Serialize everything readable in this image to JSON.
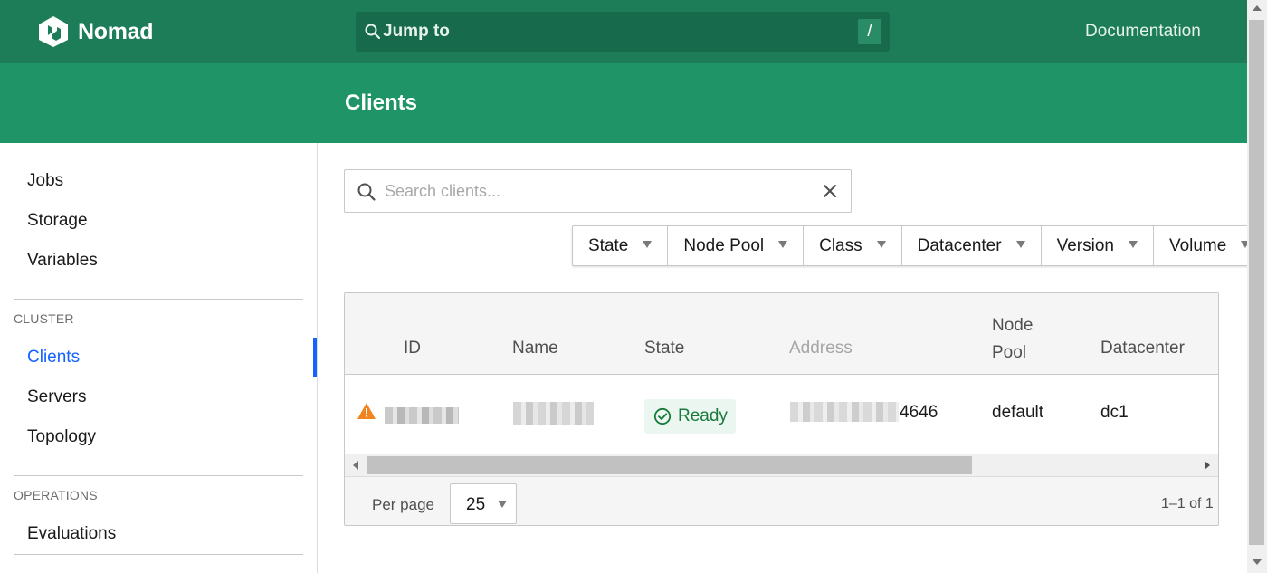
{
  "app": {
    "name": "Nomad",
    "logo_icon": "nomad-logo-icon"
  },
  "topnav": {
    "jump_label": "Jump to",
    "jump_shortcut": "/",
    "documentation": "Documentation"
  },
  "page": {
    "title": "Clients"
  },
  "sidebar": {
    "top_items": [
      "Jobs",
      "Storage",
      "Variables"
    ],
    "cluster_heading": "CLUSTER",
    "cluster_items": [
      "Clients",
      "Servers",
      "Topology"
    ],
    "operations_heading": "OPERATIONS",
    "operations_items": [
      "Evaluations"
    ],
    "active_item": "Clients"
  },
  "search": {
    "placeholder": "Search clients...",
    "value": ""
  },
  "filters": [
    "State",
    "Node Pool",
    "Class",
    "Datacenter",
    "Version",
    "Volume"
  ],
  "table": {
    "columns": [
      "ID",
      "Name",
      "State",
      "Address",
      "Node\nPool",
      "Datacenter"
    ],
    "rows": [
      {
        "id": "",
        "name": "",
        "state": "Ready",
        "address_suffix": "4646",
        "node_pool": "default",
        "datacenter": "dc1",
        "warning": true
      }
    ]
  },
  "footer": {
    "per_page_label": "Per page",
    "per_page_value": "25",
    "pagination": "1–1 of 1"
  },
  "colors": {
    "nav": "#1d7d59",
    "subnav": "#1f9467",
    "active": "#1563ff",
    "ready": "#177a3a",
    "warning": "#f0841e"
  }
}
